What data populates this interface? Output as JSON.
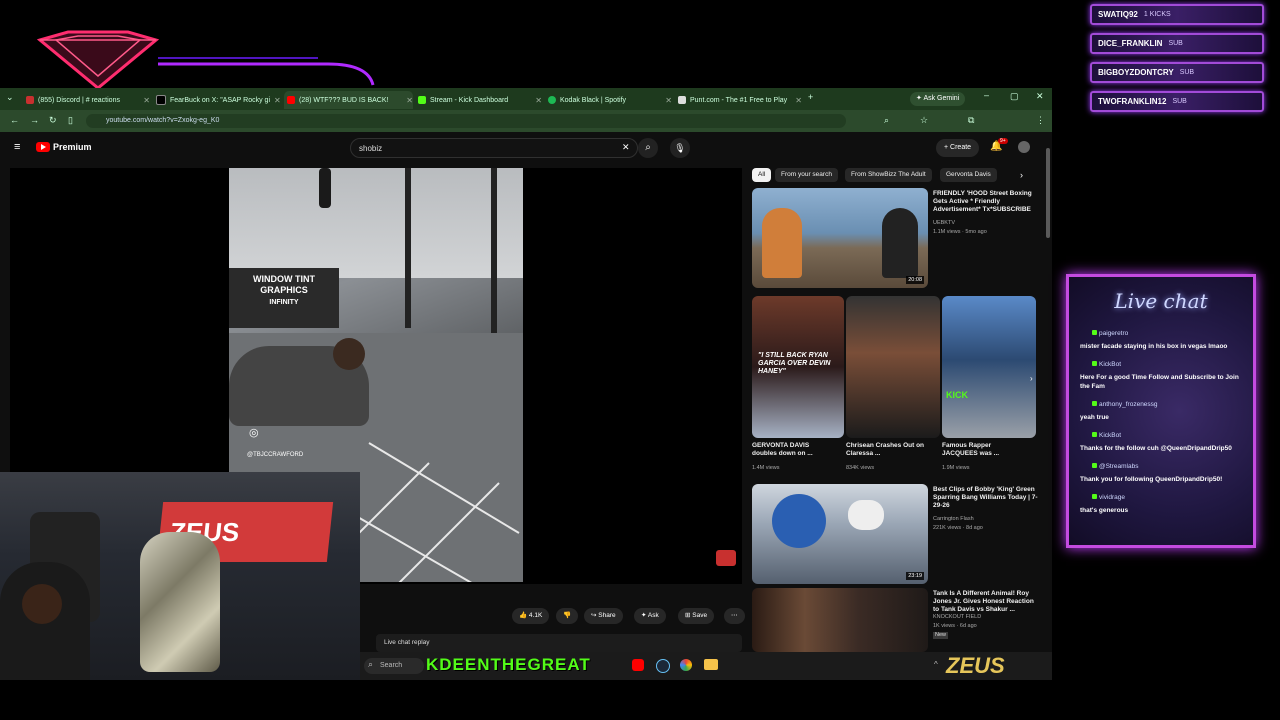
{
  "events": [
    {
      "name": "SWATIQ92",
      "type": "1 KICKS"
    },
    {
      "name": "DICE_FRANKLIN",
      "type": "SUB"
    },
    {
      "name": "BIGBOYZDONTCRY",
      "type": "SUB"
    },
    {
      "name": "TWOFRANKLIN12",
      "type": "SUB"
    }
  ],
  "tabs": [
    {
      "label": "(855) Discord | # reactions"
    },
    {
      "label": "FearBuck on X: \"ASAP Rocky gi"
    },
    {
      "label": "(28) WTF??? BUD IS BACK!"
    },
    {
      "label": "Stream - Kick Dashboard"
    },
    {
      "label": "Kodak Black | Spotify"
    },
    {
      "label": "Punt.com - The #1 Free to Play"
    }
  ],
  "browser": {
    "url": "youtube.com/watch?v=Zxokg-eg_K0",
    "gemini": "Ask Gemini"
  },
  "youtube": {
    "brand": "Premium",
    "search_value": "shobiz",
    "create": "Create",
    "notif_count": "9+",
    "chips": [
      "All",
      "From your search",
      "From ShowBizz The Adult",
      "Gervonta Davis"
    ],
    "videos": [
      {
        "title": "FRIENDLY 'HOOD Street Boxing Gets Active * Friendly Advertisement* Tx*SUBSCRIBE",
        "channel": "UEBKTV",
        "meta": "1.1M views · 5mo ago",
        "duration": "20:08"
      },
      {
        "title": "GERVONTA DAVIS doubles down on ...",
        "meta": "1.4M views"
      },
      {
        "title": "Chrisean Crashes Out on Claressa ...",
        "meta": "834K views"
      },
      {
        "title": "Famous Rapper JACQUEES was ...",
        "meta": "1.9M views"
      },
      {
        "title": "Best Clips of Bobby 'King' Green Sparring Bang Williams Today | 7-29-26",
        "channel": "Carrington Flash",
        "meta": "221K views · 8d ago",
        "duration": "23:19"
      },
      {
        "title": "Tank Is A Different Animal! Roy Jones Jr. Gives Honest Reaction to Tank Davis vs Shakur ...",
        "channel": "KNOCKOUT FIELD",
        "meta": "1K views · 6d ago",
        "badge": "New"
      }
    ],
    "short_caption": "\"I STILL BACK RYAN GARCIA OVER DEVIN HANEY\"",
    "kick_text": "KICK",
    "likes": "4.1K",
    "share": "Share",
    "ask": "Ask",
    "save": "Save",
    "live_replay": "Live chat replay",
    "video_overlay": {
      "sign1": "WINDOW TINT GRAPHICS",
      "sign2": "INFINITY",
      "handle": "@TBJCCRAWFORD"
    }
  },
  "cam": {
    "sign": "ZEUS"
  },
  "taskbar": {
    "search": "Search",
    "kick_name": "KDEENTHEGREAT",
    "brand": "ZEUS"
  },
  "chat": {
    "title": "Live chat",
    "messages": [
      {
        "user": "paigeretro",
        "text": "mister facade staying in his box in vegas lmaoo"
      },
      {
        "user": "KickBot",
        "text": "Here For a good Time Follow and Subscribe to Join the Fam"
      },
      {
        "user": "anthony_frozenessg",
        "text": "yeah true"
      },
      {
        "user": "KickBot",
        "text": "Thanks for the follow cuh @QueenDripandDrip50"
      },
      {
        "user": "@Streamlabs",
        "text": "Thank you for following QueenDripandDrip50!"
      },
      {
        "user": "vividrage",
        "text": "that's generous"
      }
    ]
  }
}
